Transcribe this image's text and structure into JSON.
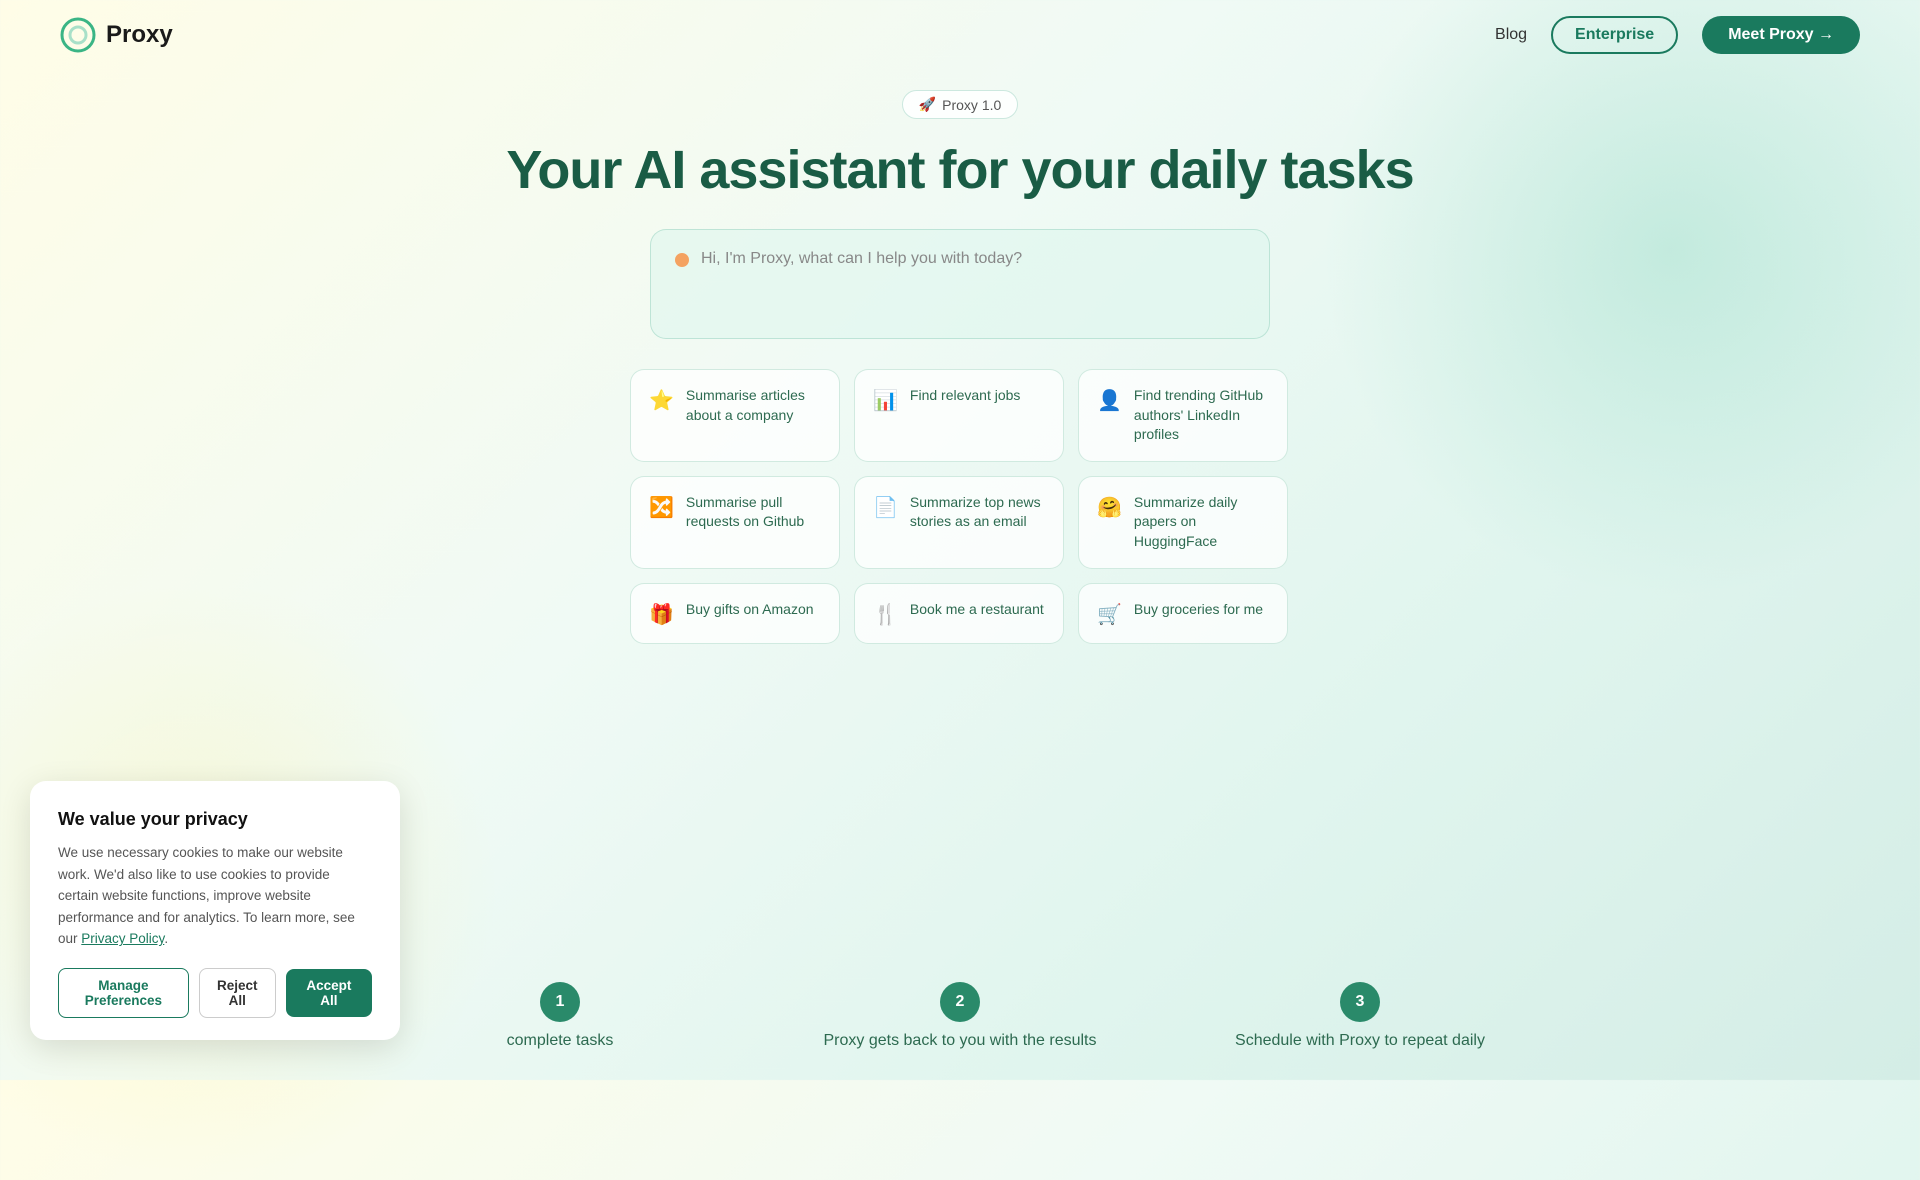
{
  "nav": {
    "logo_text": "Proxy",
    "blog_label": "Blog",
    "enterprise_label": "Enterprise",
    "meet_proxy_label": "Meet Proxy →"
  },
  "badge": {
    "emoji": "🚀",
    "text": "Proxy 1.0"
  },
  "hero": {
    "title": "Your AI assistant for your daily tasks"
  },
  "chat": {
    "placeholder": "Hi, I'm Proxy, what can I help you with today?"
  },
  "cards": [
    {
      "id": "card-summarise-articles",
      "icon": "⭐",
      "text": "Summarise articles about a company"
    },
    {
      "id": "card-find-jobs",
      "icon": "📊",
      "text": "Find relevant jobs"
    },
    {
      "id": "card-github-linkedin",
      "icon": "👤",
      "text": "Find trending GitHub authors' LinkedIn profiles"
    },
    {
      "id": "card-pull-requests",
      "icon": "🔀",
      "text": "Summarise pull requests on Github"
    },
    {
      "id": "card-summarize-news",
      "icon": "📄",
      "text": "Summarize top news stories as an email"
    },
    {
      "id": "card-huggingface",
      "icon": "🤗",
      "text": "Summarize daily papers on HuggingFace"
    },
    {
      "id": "card-amazon",
      "icon": "🎁",
      "text": "Buy gifts on Amazon"
    },
    {
      "id": "card-restaurant",
      "icon": "🍴",
      "text": "Book me a restaurant"
    },
    {
      "id": "card-groceries",
      "icon": "🛒",
      "text": "Buy groceries for me"
    }
  ],
  "steps": [
    {
      "number": "1",
      "text": "complete tasks"
    },
    {
      "number": "2",
      "text": "Proxy gets back to you with the results"
    },
    {
      "number": "3",
      "text": "Schedule with Proxy to repeat daily"
    }
  ],
  "cookie": {
    "title": "We value your privacy",
    "body": "We use necessary cookies to make our website work. We'd also like to use cookies to provide certain website functions, improve website performance and for analytics. To learn more, see our",
    "link_text": "Privacy Policy",
    "manage_label": "Manage Preferences",
    "reject_label": "Reject All",
    "accept_label": "Accept All"
  }
}
